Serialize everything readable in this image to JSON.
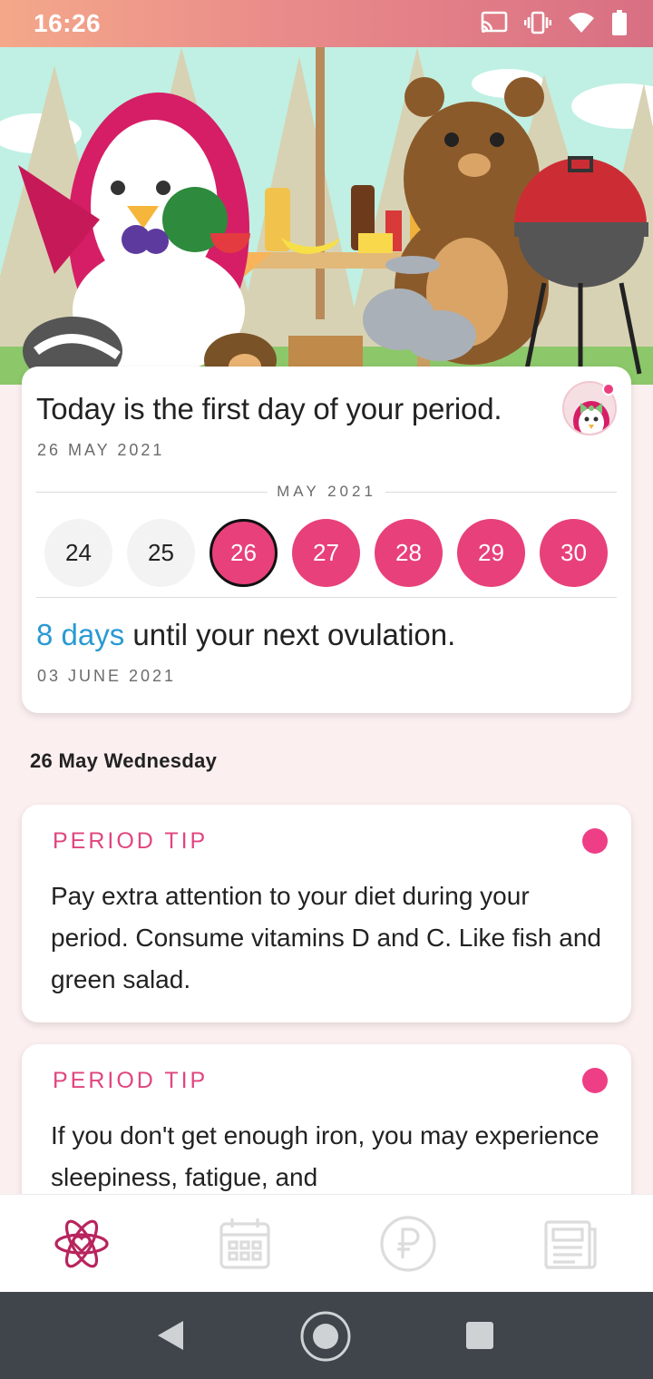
{
  "status_bar": {
    "time": "16:26",
    "icons": [
      "cast-icon",
      "vibrate-icon",
      "wifi-icon",
      "battery-icon"
    ]
  },
  "summary": {
    "title": "Today is the first day of your period.",
    "date": "26 MAY 2021",
    "month_label": "MAY 2021",
    "days": [
      {
        "label": "24",
        "state": "normal"
      },
      {
        "label": "25",
        "state": "normal"
      },
      {
        "label": "26",
        "state": "today"
      },
      {
        "label": "27",
        "state": "period"
      },
      {
        "label": "28",
        "state": "period"
      },
      {
        "label": "29",
        "state": "period"
      },
      {
        "label": "30",
        "state": "period"
      }
    ],
    "ovulation_highlight": "8 days",
    "ovulation_text": " until your next ovulation.",
    "ovulation_date": "03 JUNE 2021"
  },
  "day_heading": "26 May Wednesday",
  "tips": [
    {
      "label": "PERIOD TIP",
      "text": "Pay extra attention to your diet during your period. Consume vitamins D and C. Like fish and green salad."
    },
    {
      "label": "PERIOD TIP",
      "text": "If you don't get enough iron, you may experience sleepiness, fatigue, and"
    }
  ],
  "bottom_nav": [
    {
      "icon": "atom-heart-icon",
      "active": true
    },
    {
      "icon": "calendar-icon",
      "active": false
    },
    {
      "icon": "premium-coin-icon",
      "active": false
    },
    {
      "icon": "articles-icon",
      "active": false
    }
  ],
  "colors": {
    "accent": "#e8407a",
    "ovulation": "#2a9ad3",
    "background": "#fcefef",
    "nav_active": "#b8245d",
    "nav_inactive": "#dcdcdc"
  }
}
